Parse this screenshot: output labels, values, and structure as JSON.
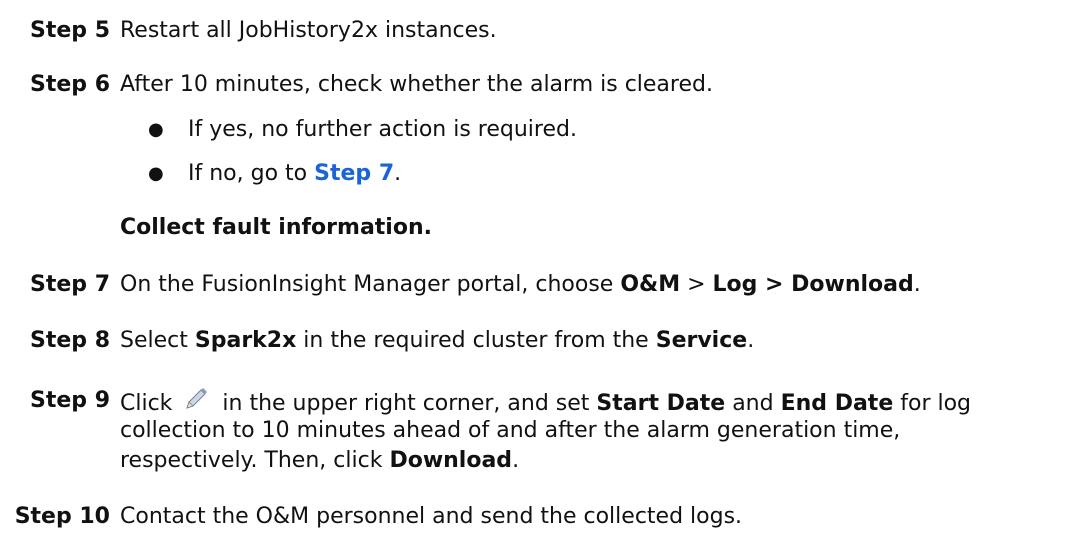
{
  "steps": [
    {
      "label": "Step 5",
      "text": "Restart all JobHistory2x instances."
    },
    {
      "label": "Step 6",
      "text": "After 10 minutes, check whether the alarm is cleared.",
      "bullets": [
        {
          "text": "If yes, no further action is required."
        },
        {
          "prefix": "If no, go to ",
          "link": "Step 7",
          "suffix": "."
        }
      ]
    },
    {
      "heading": "Collect fault information."
    },
    {
      "label": "Step 7",
      "pre": "On the FusionInsight Manager portal, choose ",
      "b1": "O&M",
      "mid": " > ",
      "b2": "Log > Download",
      "end": "."
    },
    {
      "label": "Step 8",
      "pre": "Select ",
      "b1": "Spark2x",
      "mid": " in the required cluster from the ",
      "b2": "Service",
      "end": "."
    },
    {
      "label": "Step 9",
      "line1_pre": "Click ",
      "icon": "pencil-edit-icon",
      "line1_mid": " in the upper right corner, and set ",
      "b1": "Start Date",
      "line1_and": " and ",
      "b2": "End Date",
      "line1_end": " for log",
      "line2": "collection to 10 minutes ahead of and after the alarm generation time,",
      "line3_pre": "respectively. Then, click ",
      "b3": "Download",
      "line3_end": "."
    },
    {
      "label": "Step 10",
      "text": "Contact the O&M personnel and send the collected logs."
    }
  ],
  "bullet_char": "●",
  "colors": {
    "link": "#1a64d8",
    "text": "#111111"
  }
}
